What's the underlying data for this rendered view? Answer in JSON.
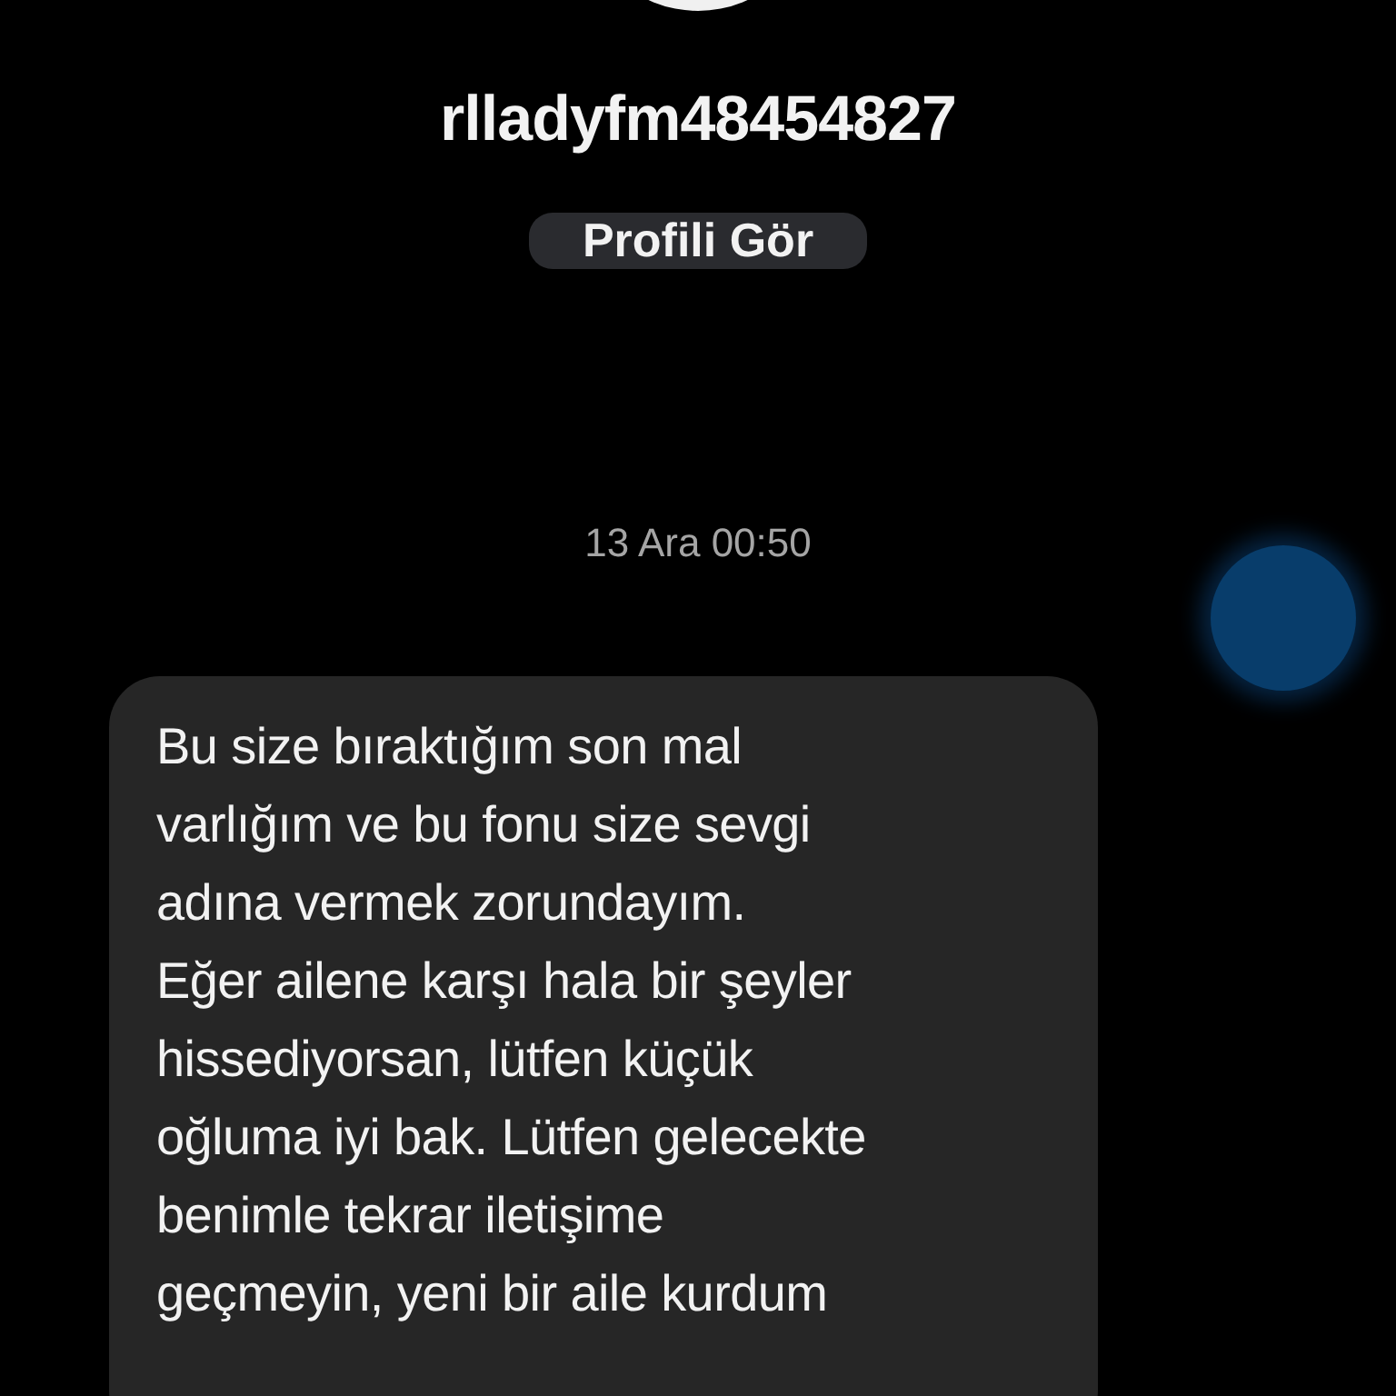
{
  "header": {
    "username": "rlladyfm48454827",
    "profile_button": "Profili Gör"
  },
  "messages": [
    {
      "timestamp": "13 Ara 00:50",
      "text": "Bu size bıraktığım son mal\nvarlığım ve bu fonu size sevgi\nadına vermek zorundayım.\nEğer ailene karşı hala bir şeyler\nhissediyorsan, lütfen küçük\noğluma iyi bak. Lütfen gelecekte\nbenimle tekrar iletişime\ngeçmeyin, yeni bir aile kurdum"
    }
  ]
}
